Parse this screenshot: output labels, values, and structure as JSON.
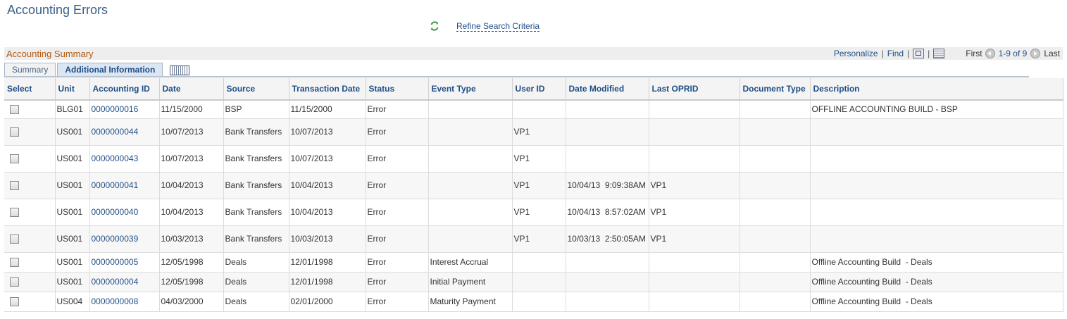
{
  "page": {
    "title": "Accounting Errors"
  },
  "refine": {
    "label": "Refine Search Criteria"
  },
  "grid": {
    "title": "Accounting Summary",
    "nav": {
      "personalize": "Personalize",
      "find": "Find",
      "first": "First",
      "range": "1-9 of 9",
      "last": "Last"
    },
    "tabs": [
      "Summary",
      "Additional Information"
    ],
    "active_tab": "Additional Information",
    "columns": [
      "Select",
      "Unit",
      "Accounting ID",
      "Date",
      "Source",
      "Transaction Date",
      "Status",
      "Event Type",
      "User ID",
      "Date Modified",
      "Last OPRID",
      "Document Type",
      "Description"
    ],
    "rows": [
      [
        "",
        "BLG01",
        "0000000016",
        "11/15/2000",
        "BSP",
        "11/15/2000",
        "Error",
        "",
        "",
        "",
        "",
        "",
        "OFFLINE ACCOUNTING BUILD - BSP"
      ],
      [
        "",
        "US001",
        "0000000044",
        "10/07/2013",
        "Bank Transfers",
        "10/07/2013",
        "Error",
        "",
        "VP1",
        "",
        "",
        "",
        ""
      ],
      [
        "",
        "US001",
        "0000000043",
        "10/07/2013",
        "Bank Transfers",
        "10/07/2013",
        "Error",
        "",
        "VP1",
        "",
        "",
        "",
        ""
      ],
      [
        "",
        "US001",
        "0000000041",
        "10/04/2013",
        "Bank Transfers",
        "10/04/2013",
        "Error",
        "",
        "VP1",
        "10/04/13  9:09:38AM",
        "VP1",
        "",
        ""
      ],
      [
        "",
        "US001",
        "0000000040",
        "10/04/2013",
        "Bank Transfers",
        "10/04/2013",
        "Error",
        "",
        "VP1",
        "10/04/13  8:57:02AM",
        "VP1",
        "",
        ""
      ],
      [
        "",
        "US001",
        "0000000039",
        "10/03/2013",
        "Bank Transfers",
        "10/03/2013",
        "Error",
        "",
        "VP1",
        "10/03/13  2:50:05AM",
        "VP1",
        "",
        ""
      ],
      [
        "",
        "US001",
        "0000000005",
        "12/05/1998",
        "Deals",
        "12/01/1998",
        "Error",
        "Interest Accrual",
        "",
        "",
        "",
        "",
        "Offline Accounting Build  - Deals"
      ],
      [
        "",
        "US001",
        "0000000004",
        "12/05/1998",
        "Deals",
        "12/01/1998",
        "Error",
        "Initial Payment",
        "",
        "",
        "",
        "",
        "Offline Accounting Build  - Deals"
      ],
      [
        "",
        "US004",
        "0000000008",
        "04/03/2000",
        "Deals",
        "02/01/2000",
        "Error",
        "Maturity Payment",
        "",
        "",
        "",
        "",
        "Offline Accounting Build  - Deals"
      ]
    ]
  },
  "colors": {
    "link": "#1f4e86",
    "grid_title": "#b25a10",
    "page_title": "#3a5e88"
  }
}
